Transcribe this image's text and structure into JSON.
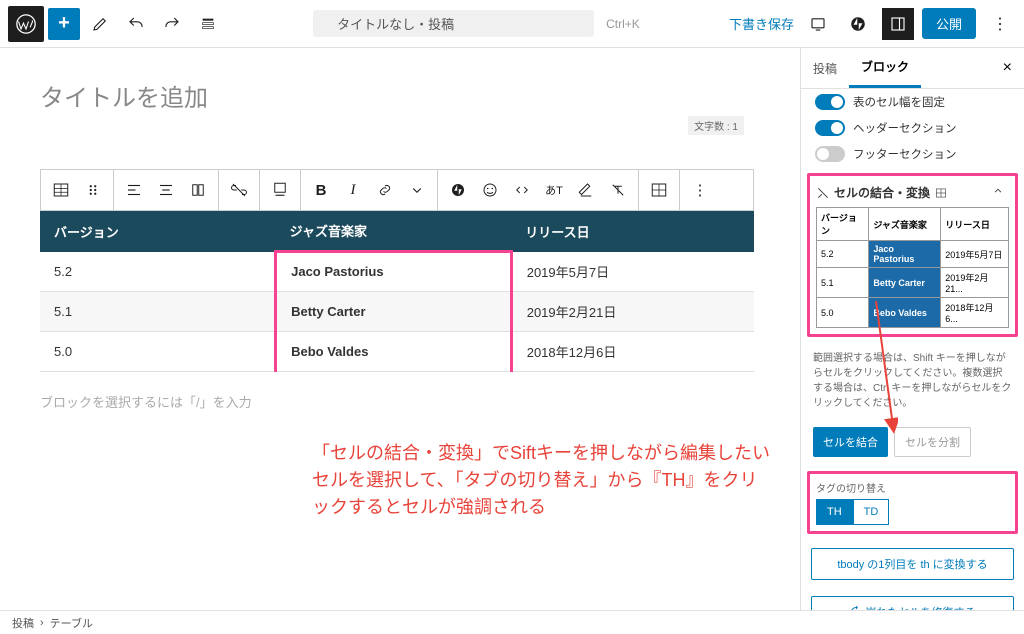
{
  "topbar": {
    "doc_title": "タイトルなし・投稿",
    "shortcut": "Ctrl+K",
    "draft_save": "下書き保存",
    "publish": "公開"
  },
  "editor": {
    "title_placeholder": "タイトルを追加",
    "char_count": "文字数 : 1",
    "block_placeholder": "ブロックを選択するには「/」を入力"
  },
  "table": {
    "headers": [
      "バージョン",
      "ジャズ音楽家",
      "リリース日"
    ],
    "rows": [
      [
        "5.2",
        "Jaco Pastorius",
        "2019年5月7日"
      ],
      [
        "5.1",
        "Betty Carter",
        "2019年2月21日"
      ],
      [
        "5.0",
        "Bebo Valdes",
        "2018年12月6日"
      ]
    ]
  },
  "annotation": "「セルの結合・変換」でSiftキーを押しながら編集したいセルを選択して、「タブの切り替え」から『TH』をクリックするとセルが強調される",
  "sidebar": {
    "tabs": {
      "post": "投稿",
      "block": "ブロック"
    },
    "toggles": {
      "fixed_width": "表のセル幅を固定",
      "header_section": "ヘッダーセクション",
      "footer_section": "フッターセクション"
    },
    "panel_title": "セルの結合・変換",
    "mini_headers": [
      "バージョン",
      "ジャズ音楽家",
      "リリース日"
    ],
    "mini_rows": [
      [
        "5.2",
        "Jaco Pastorius",
        "2019年5月7日"
      ],
      [
        "5.1",
        "Betty Carter",
        "2019年2月21..."
      ],
      [
        "5.0",
        "Bebo Valdes",
        "2018年12月6..."
      ]
    ],
    "help": "範囲選択する場合は、Shift キーを押しながらセルをクリックしてください。複数選択する場合は、Ctrl キーを押しながらセルをクリックしてください。",
    "merge_btn": "セルを結合",
    "split_btn": "セルを分割",
    "tag_label": "タグの切り替え",
    "tag_th": "TH",
    "tag_td": "TD",
    "convert_btn": "tbody の1列目を th に変換する",
    "repair_btn": "崩れたセルを修復する"
  },
  "breadcrumb": {
    "post": "投稿",
    "table": "テーブル"
  },
  "colors": {
    "accent": "#007cba",
    "highlight": "#f54291",
    "header_bg": "#1c4a5d"
  }
}
